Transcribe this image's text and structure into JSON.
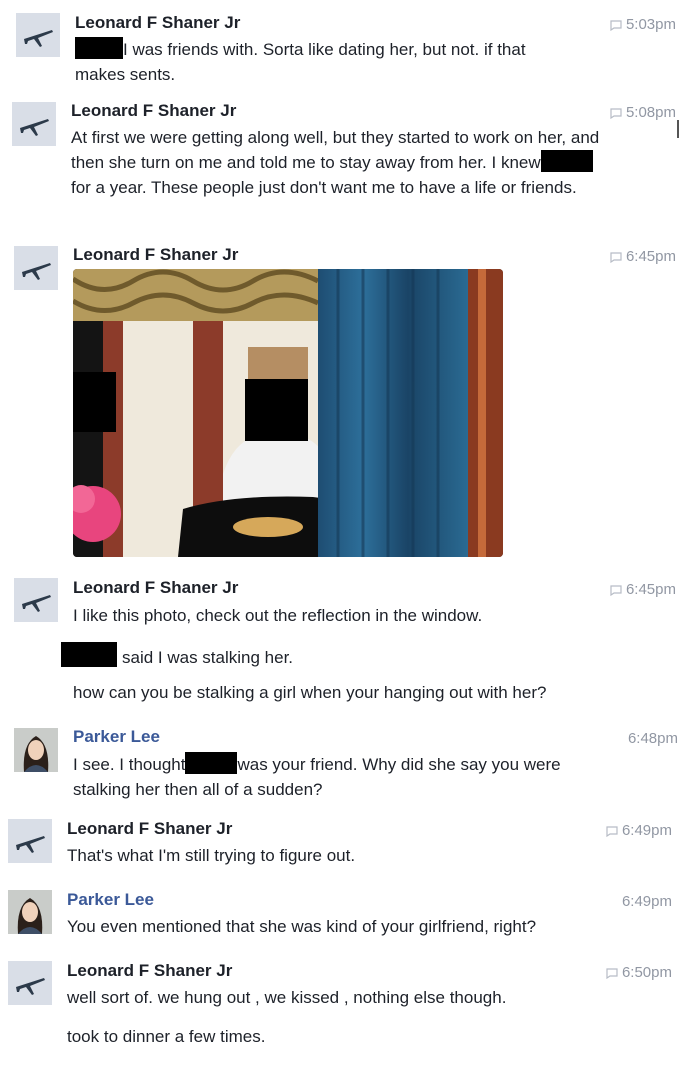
{
  "chat": {
    "groups": [
      {
        "sender": "Leonard F Shaner Jr",
        "time": "5:03pm",
        "avatar_icon": "airplane-avatar-icon",
        "messages": [
          {
            "before": "",
            "after": "I was friends with. Sorta like dating her, but not. if that makes sents."
          }
        ]
      },
      {
        "sender": "Leonard F Shaner Jr",
        "time": "5:08pm",
        "avatar_icon": "airplane-avatar-icon",
        "messages": [
          {
            "before": "At first we were getting along well, but they started to work on her, and then she turn on me and told me to stay away from her.  I knew",
            "after": "for a year. These people just don't want me to have a life or friends."
          }
        ]
      },
      {
        "sender": "Leonard F Shaner Jr",
        "time": "6:45pm",
        "avatar_icon": "airplane-avatar-icon",
        "photo": "shared-photo"
      },
      {
        "sender": "Leonard F Shaner Jr",
        "time": "6:45pm",
        "avatar_icon": "airplane-avatar-icon",
        "messages": [
          {
            "text": "I like this photo, check out the reflection in the window."
          },
          {
            "after": "said I was stalking her."
          },
          {
            "text": "how can you be stalking a girl when your hanging out with her?"
          }
        ]
      },
      {
        "sender": "Parker Lee",
        "time": "6:48pm",
        "avatar_icon": "woman-avatar-icon",
        "messages": [
          {
            "before": "I see. I thought",
            "after": "was your friend. Why did she say you were stalking her then all of a sudden?"
          }
        ]
      },
      {
        "sender": "Leonard F Shaner Jr",
        "time": "6:49pm",
        "avatar_icon": "airplane-avatar-icon",
        "messages": [
          {
            "text": "That's what I'm still trying  to figure out."
          }
        ]
      },
      {
        "sender": "Parker Lee",
        "time": "6:49pm",
        "avatar_icon": "woman-avatar-icon",
        "messages": [
          {
            "text": "You even mentioned that she was kind of your girlfriend, right?"
          }
        ]
      },
      {
        "sender": "Leonard F Shaner Jr",
        "time": "6:50pm",
        "avatar_icon": "airplane-avatar-icon",
        "messages": [
          {
            "text": "well sort of. we hung out , we kissed , nothing else though."
          },
          {
            "text": "took to dinner a few times."
          }
        ]
      }
    ]
  },
  "colors": {
    "text": "#1d2129",
    "link_name": "#3b5998",
    "timestamp": "#9197a3",
    "redaction": "#000000"
  }
}
